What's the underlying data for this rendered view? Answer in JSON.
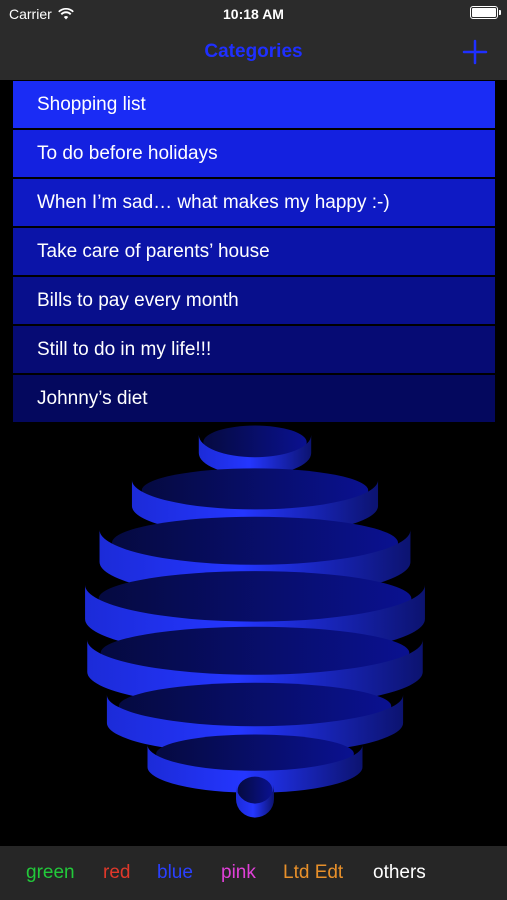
{
  "status": {
    "carrier": "Carrier",
    "time": "10:18 AM"
  },
  "nav": {
    "title": "Categories",
    "add_icon": "plus-icon"
  },
  "categories": [
    {
      "label": "Shopping list",
      "color": "#1a2cf5"
    },
    {
      "label": "To do before holidays",
      "color": "#1421e0"
    },
    {
      "label": "When I’m sad… what makes my happy :-)",
      "color": "#0f1ac4"
    },
    {
      "label": "Take care of parents’ house",
      "color": "#0b14a8"
    },
    {
      "label": "Bills to pay every month",
      "color": "#080f8c"
    },
    {
      "label": "Still to do in my life!!!",
      "color": "#060b74"
    },
    {
      "label": "Johnny’s diet",
      "color": "#04085e"
    }
  ],
  "tabs": [
    {
      "label": "green",
      "color": "#22c93a"
    },
    {
      "label": "red",
      "color": "#e0382a"
    },
    {
      "label": "blue",
      "color": "#2a40ff"
    },
    {
      "label": "pink",
      "color": "#e040d8"
    },
    {
      "label": "Ltd Edt",
      "color": "#e8902a"
    },
    {
      "label": "others",
      "color": "#ffffff"
    }
  ],
  "accent": "#1f2fff"
}
